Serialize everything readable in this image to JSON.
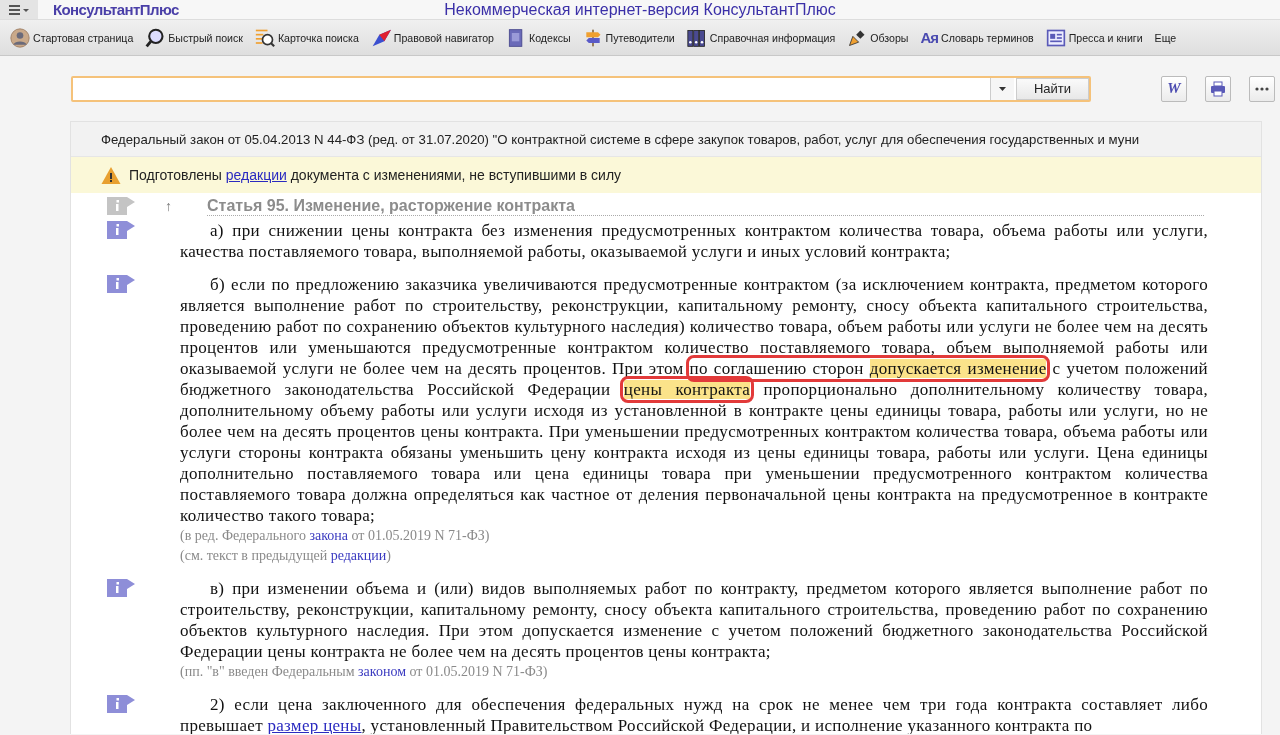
{
  "top_bar": {
    "logo": "КонсультантПлюс",
    "title": "Некоммерческая интернет-версия КонсультантПлюс"
  },
  "toolbar": [
    {
      "label": "Стартовая страница"
    },
    {
      "label": "Быстрый поиск"
    },
    {
      "label": "Карточка поиска"
    },
    {
      "label": "Правовой навигатор"
    },
    {
      "label": "Кодексы"
    },
    {
      "label": "Путеводители"
    },
    {
      "label": "Справочная информация"
    },
    {
      "label": "Обзоры"
    },
    {
      "label": "Словарь терминов",
      "icon_text": "Ая"
    },
    {
      "label": "Пресса и книги"
    },
    {
      "label": "Еще"
    }
  ],
  "search": {
    "button": "Найти",
    "word_button": "W"
  },
  "document": {
    "title": "Федеральный закон от 05.04.2013 N 44-ФЗ (ред. от 31.07.2020) \"О контрактной системе в сфере закупок товаров, работ, услуг для обеспечения государственных и муни",
    "notice": [
      {
        "kind": "text",
        "text": "Подготовлены "
      },
      {
        "kind": "link",
        "text": "редакции"
      },
      {
        "kind": "text",
        "text": " документа с изменениями, не вступившими в силу"
      }
    ],
    "article": {
      "up_arrow": "↑",
      "heading": "Статья 95. Изменение, расторжение контракта"
    },
    "paragraphs": [
      {
        "kind": "clause",
        "parts": [
          {
            "kind": "text",
            "text": "а) при снижении цены контракта без изменения предусмотренных контрактом количества товара, объема работы или услуги, качества поставляемого товара, выполняемой работы, оказываемой услуги и иных условий контракта;"
          }
        ]
      },
      {
        "kind": "clause",
        "parts": [
          {
            "kind": "text",
            "text": "б) если по предложению заказчика увеличиваются предусмотренные контрактом (за исключением контракта, предметом которого является выполнение работ по строительству, реконструкции, капитальному ремонту, сносу объекта капитального строительства, проведению работ по сохранению объектов культурного наследия) количество товара, объем работы или услуги не более чем на десять процентов или уменьшаются предусмотренные контрактом количество поставляемого товара, объем выполняемой работы или оказываемой услуги не более чем на десять процентов. При этом "
          },
          {
            "kind": "boxed",
            "parts": [
              {
                "kind": "text",
                "text": "по соглашению сторон "
              },
              {
                "kind": "highlight",
                "text": "допускается изменение"
              }
            ]
          },
          {
            "kind": "text",
            "text": " с учетом положений бюджетного законодательства Российской Федерации "
          },
          {
            "kind": "boxed",
            "parts": [
              {
                "kind": "highlight",
                "text": "цены контракта"
              }
            ]
          },
          {
            "kind": "text",
            "text": " пропорционально дополнительному количеству товара, дополнительному объему работы или услуги исходя из установленной в контракте цены единицы товара, работы или услуги, но не более чем на десять процентов цены контракта. При уменьшении предусмотренных контрактом количества товара, объема работы или услуги стороны контракта обязаны уменьшить цену контракта исходя из цены единицы товара, работы или услуги. Цена единицы дополнительно поставляемого товара или цена единицы товара при уменьшении предусмотренного контрактом количества поставляемого товара должна определяться как частное от деления первоначальной цены контракта на предусмотренное в контракте количество такого товара;"
          }
        ]
      },
      {
        "kind": "note",
        "parts": [
          {
            "kind": "text",
            "text": "(в ред. Федерального "
          },
          {
            "kind": "link",
            "text": "закона"
          },
          {
            "kind": "text",
            "text": " от 01.05.2019 N 71-ФЗ)"
          }
        ]
      },
      {
        "kind": "note",
        "parts": [
          {
            "kind": "text",
            "text": "(см. текст в предыдущей "
          },
          {
            "kind": "link",
            "text": "редакции"
          },
          {
            "kind": "text",
            "text": ")"
          }
        ]
      },
      {
        "kind": "clause",
        "parts": [
          {
            "kind": "text",
            "text": "в) при изменении объема и (или) видов выполняемых работ по контракту, предметом которого является выполнение работ по строительству, реконструкции, капитальному ремонту, сносу объекта капитального строительства, проведению работ по сохранению объектов культурного наследия. При этом допускается изменение с учетом положений бюджетного законодательства Российской Федерации цены контракта не более чем на десять процентов цены контракта;"
          }
        ]
      },
      {
        "kind": "note",
        "parts": [
          {
            "kind": "text",
            "text": "(пп. \"в\" введен Федеральным "
          },
          {
            "kind": "link",
            "text": "законом"
          },
          {
            "kind": "text",
            "text": " от 01.05.2019 N 71-ФЗ)"
          }
        ]
      },
      {
        "kind": "clause",
        "parts": [
          {
            "kind": "text",
            "text": "2) если цена заключенного для обеспечения федеральных нужд на срок не менее чем три года контракта составляет либо превышает "
          },
          {
            "kind": "link",
            "text": "размер цены"
          },
          {
            "kind": "text",
            "text": ", установленный Правительством Российской Федерации, и исполнение указанного контракта по"
          }
        ]
      }
    ]
  }
}
